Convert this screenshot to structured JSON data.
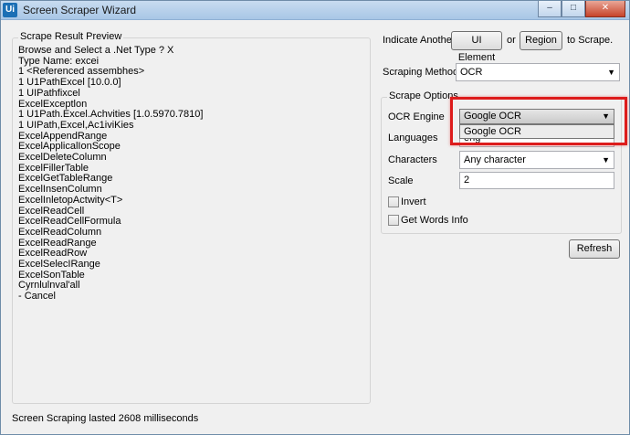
{
  "window": {
    "app_icon_text": "Ui",
    "title": "Screen Scraper Wizard",
    "minimize_glyph": "–",
    "maximize_glyph": "□",
    "close_glyph": "✕"
  },
  "preview": {
    "label": "Scrape Result Preview",
    "lines": [
      "Browse and Select a .Net Type ? X",
      "Type Name: excei",
      "1 <Referenced assembhes>",
      "1 U1PathExcel [10.0.0]",
      "1 UIPathfixcel",
      "ExcelExceptlon",
      "1 U1Path.Excel.Achvities [1.0.5970.7810]",
      "1 UIPath,Excel,Ac1iviKies",
      "ExcelAppendRange",
      "ExcelApplicalIonScope",
      "ExcelDeleteColumn",
      "ExcelFillerTable",
      "ExcelGetTableRange",
      "ExcelInsenColumn",
      "ExcelInletopActwity<T>",
      "ExcelReadCell",
      "ExcelReadCellFormula",
      "ExcelReadColumn",
      "ExcelReadRange",
      "ExcelReadRow",
      "ExcelSelecIRange",
      "ExcelSonTable",
      "Cyrnlulnval'all",
      "- Cancel"
    ]
  },
  "indicate": {
    "label": "Indicate Another",
    "ui_element_button": "UI Element",
    "or_label": "or",
    "region_button": "Region",
    "suffix": "to Scrape."
  },
  "scraping_method": {
    "label": "Scraping Method",
    "value": "OCR"
  },
  "options": {
    "label": "Scrape Options",
    "ocr_engine_label": "OCR Engine",
    "ocr_engine_value": "Google OCR",
    "dropdown_item": "Google OCR",
    "languages_label": "Languages",
    "languages_value": "eng",
    "characters_label": "Characters",
    "characters_value": "Any character",
    "scale_label": "Scale",
    "scale_value": "2",
    "invert_label": "Invert",
    "invert_checked": false,
    "get_words_label": "Get Words Info",
    "get_words_checked": false
  },
  "refresh_button": "Refresh",
  "status": "Screen Scraping lasted 2608 milliseconds",
  "colors": {
    "highlight": "#dd1c1c",
    "titlebar": "#b6d0ec",
    "close_button": "#c7432a"
  },
  "icons": {
    "combo_arrow": "▼"
  }
}
